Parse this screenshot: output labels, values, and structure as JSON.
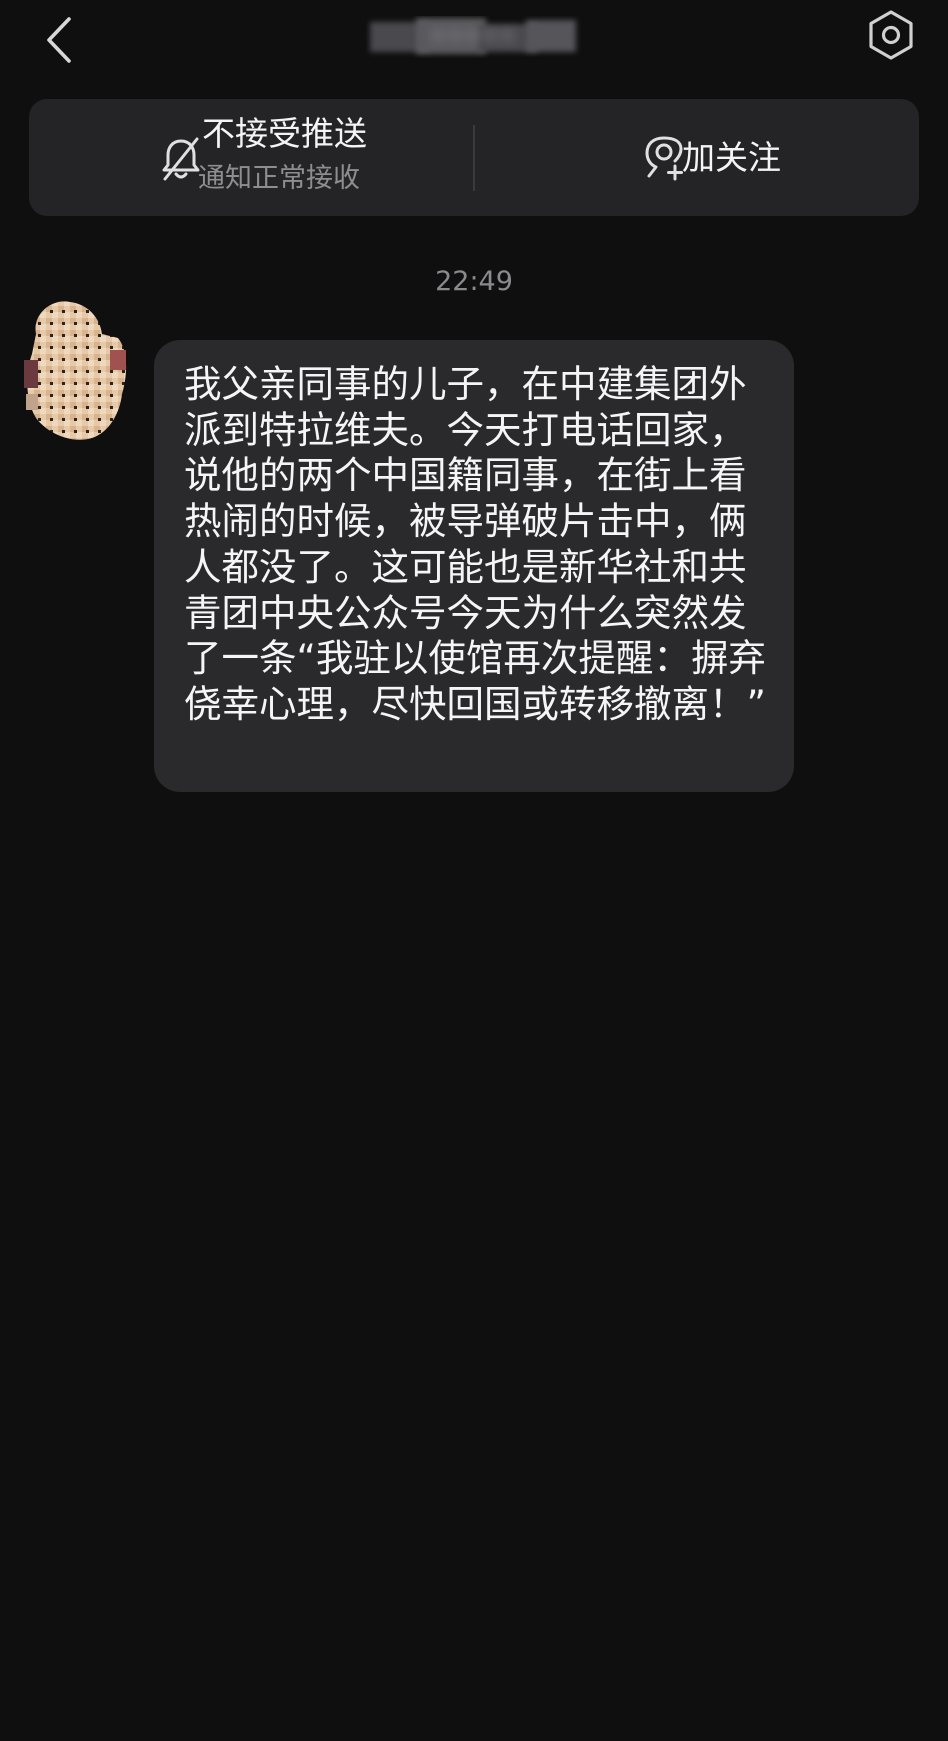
{
  "header": {
    "title": "•••••",
    "back_icon": "chevron-left-icon",
    "settings_icon": "settings-hexagon-icon"
  },
  "action_card": {
    "push": {
      "icon": "bell-off-icon",
      "title": "不接受推送",
      "subtitle": "通知正常接收"
    },
    "follow": {
      "icon": "user-add-icon",
      "label": "加关注"
    }
  },
  "chat": {
    "timestamp": "22:49",
    "messages": [
      {
        "sender": "other",
        "avatar": "blurred-avatar",
        "text": "我父亲同事的儿子，在中建集团外派到特拉维夫。今天打电话回家，说他的两个中国籍同事，在街上看热闹的时候，被导弹破片击中，俩人都没了。这可能也是新华社和共青团中央公众号今天为什么突然发了一条“我驻以使馆再次提醒：摒弃侥幸心理，尽快回国或转移撤离！”"
      }
    ]
  },
  "colors": {
    "background": "#0f0f10",
    "card": "#242427",
    "bubble": "#2a2a2d",
    "text_primary": "#f4f4f4",
    "text_secondary": "#8e8e92"
  }
}
